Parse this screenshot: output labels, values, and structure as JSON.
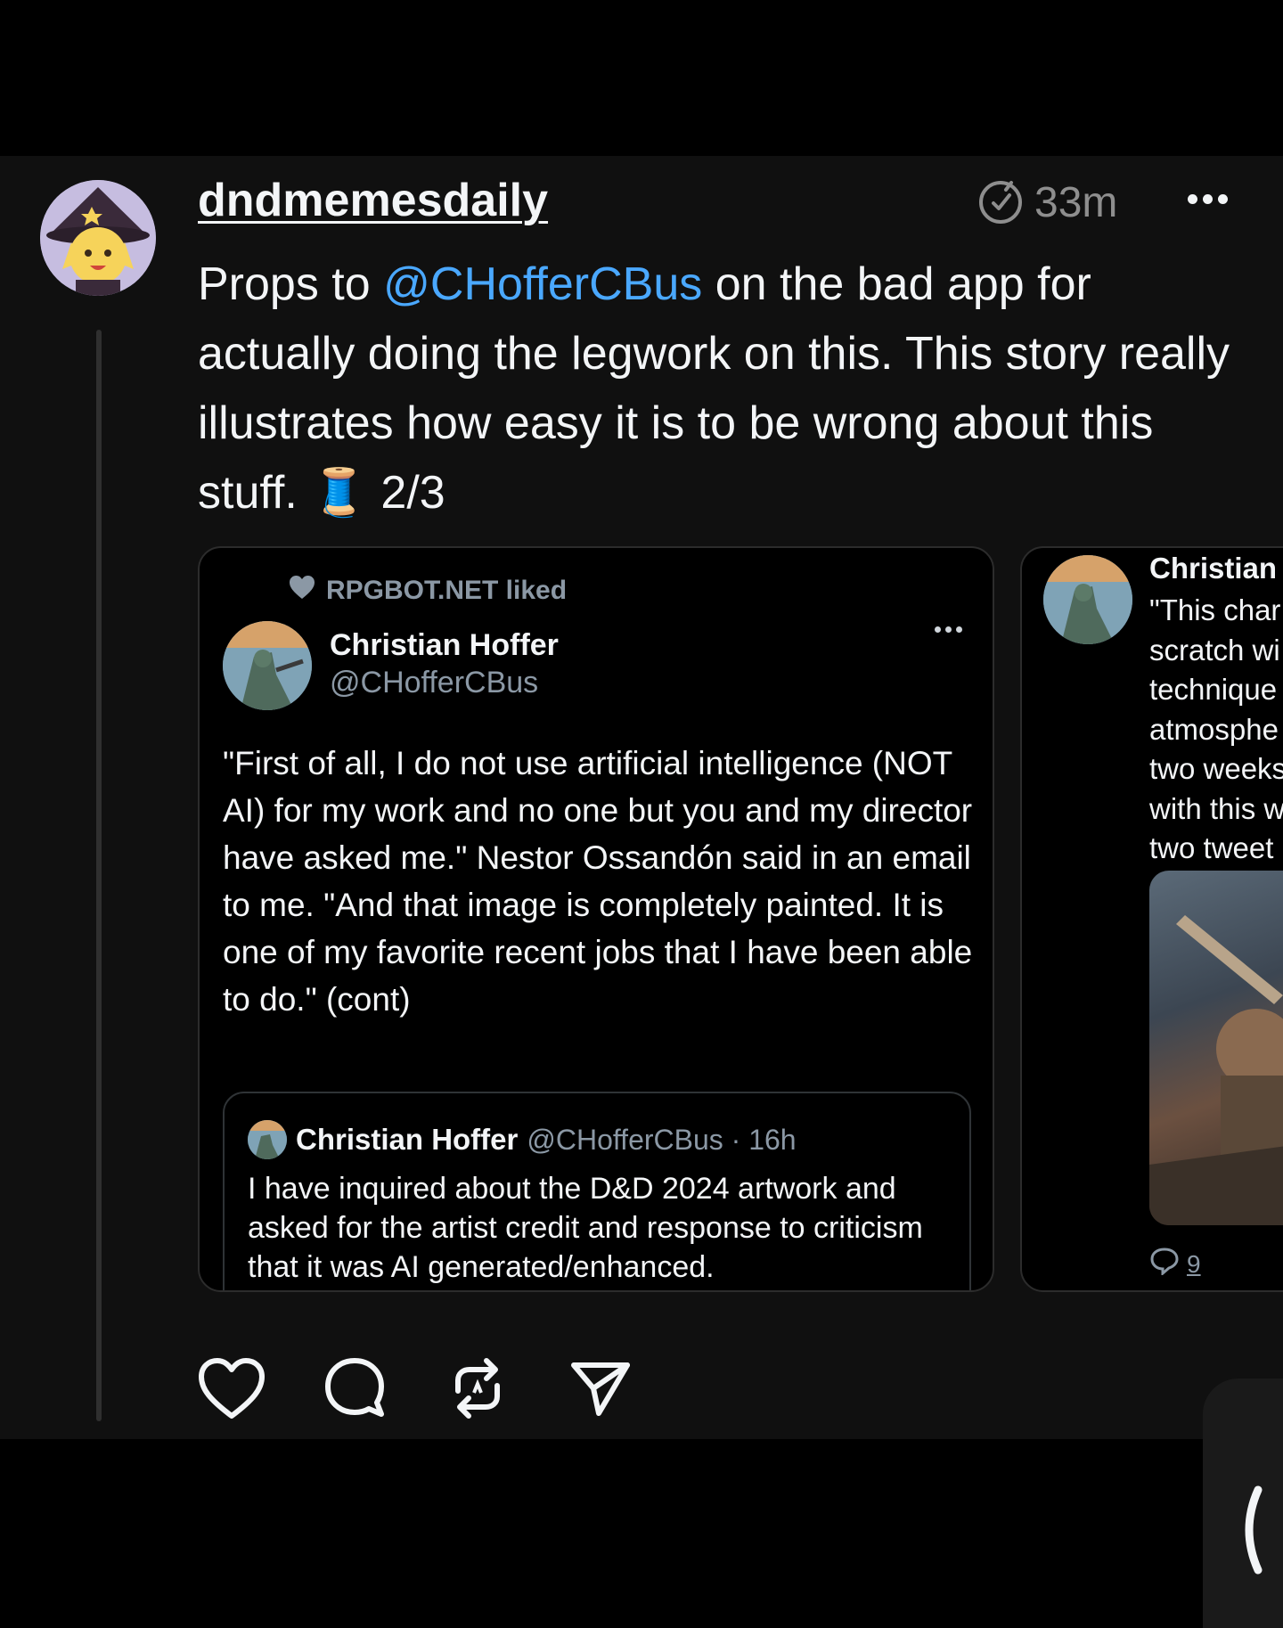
{
  "post": {
    "username": "dndmemesdaily",
    "time": "33m",
    "caption": {
      "before": "Props to ",
      "mention": "@CHofferCBus",
      "after": " on the bad app for actually doing the legwork on this. This story really illustrates how easy it is to be wrong about this stuff. 🧵 2/3"
    }
  },
  "card1": {
    "liked_by": "RPGBOT.NET liked",
    "author_name": "Christian Hoffer",
    "author_handle": "@CHofferCBus",
    "text": "\"First of all, I do not use artificial intelligence (NOT AI) for my work and no one but you and my director have asked me.\" Nestor Ossandón said in an email to me. \"And that image is completely painted. It is one of my favorite recent jobs that I have been able to do.\" (cont)",
    "quote": {
      "name": "Christian Hoffer",
      "handle_time": "@CHofferCBus · 16h",
      "text": "I have inquired about the D&D 2024 artwork and asked for the artist credit and response to criticism that it was AI generated/enhanced."
    }
  },
  "card2": {
    "author_name": "Christian",
    "text": "\"This char\nscratch wi\ntechnique\natmosphe\ntwo weeks\nwith this w\ntwo tweet",
    "reply_count": "9"
  },
  "icons": {
    "timer": "timer-icon",
    "more": "more-icon",
    "like": "heart-icon",
    "comment": "comment-icon",
    "repost": "repost-icon",
    "share": "send-icon"
  },
  "colors": {
    "background": "#000000",
    "post_background": "#101010",
    "mention": "#4aa8ff",
    "muted": "#8e8e8e"
  }
}
